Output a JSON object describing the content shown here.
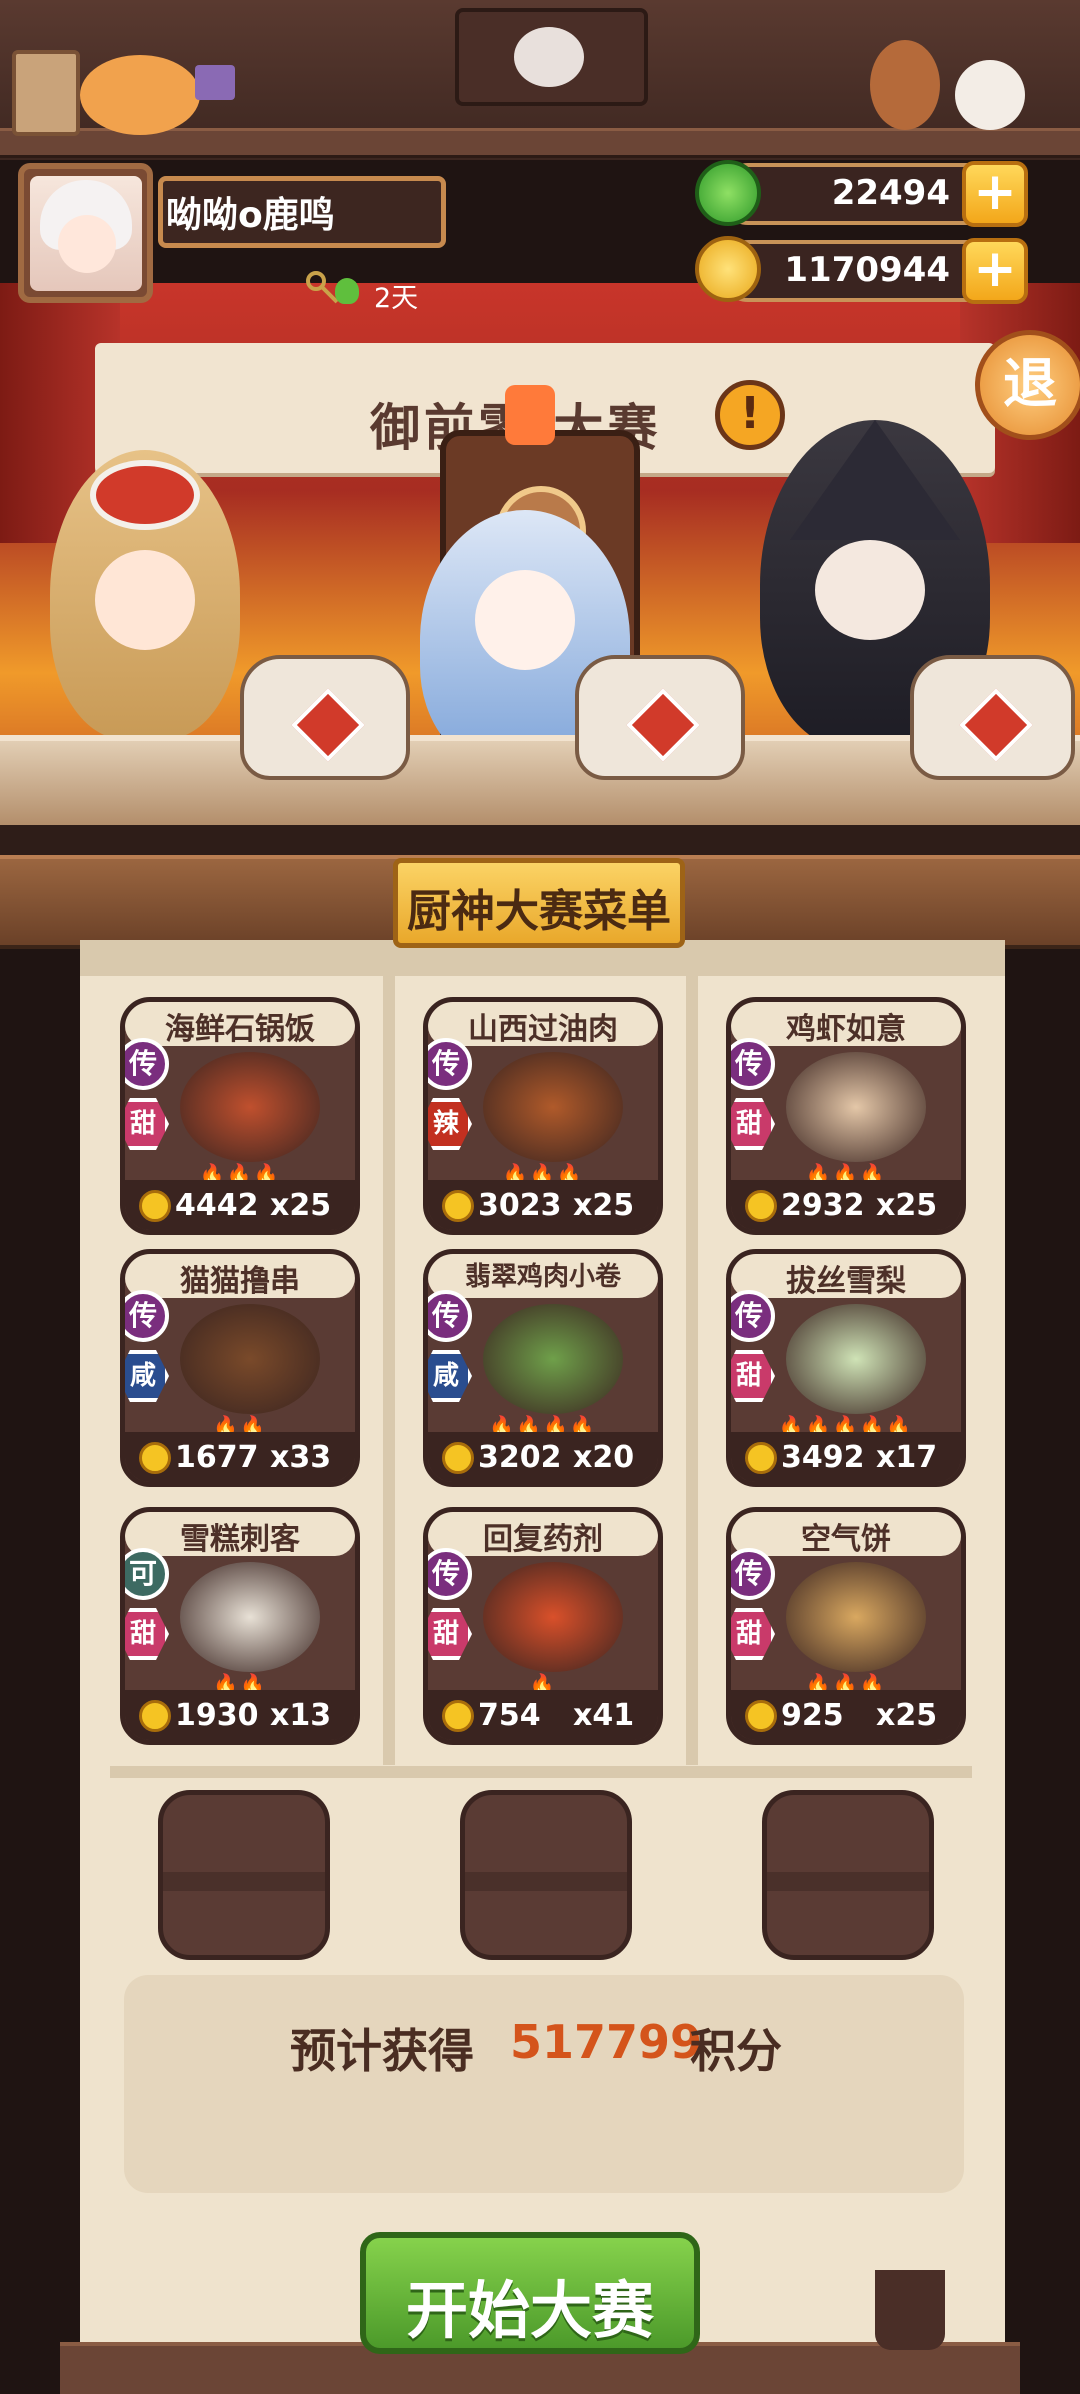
{
  "header": {
    "player_name": "呦呦o鹿鸣",
    "days": "2天",
    "jade": "22494",
    "coins": "1170944",
    "exit_label": "退"
  },
  "stage": {
    "event_title": "御前零 大赛",
    "alert_mark": "!"
  },
  "menu": {
    "title": "厨神大赛菜单",
    "dishes": [
      {
        "name": "海鲜石锅饭",
        "rarity": "传",
        "flavor": "甜",
        "flames": "🔥🔥🔥",
        "price": "4442",
        "qty": "x25"
      },
      {
        "name": "山西过油肉",
        "rarity": "传",
        "flavor": "辣",
        "flames": "🔥🔥🔥",
        "price": "3023",
        "qty": "x25"
      },
      {
        "name": "鸡虾如意",
        "rarity": "传",
        "flavor": "甜",
        "flames": "🔥🔥🔥",
        "price": "2932",
        "qty": "x25"
      },
      {
        "name": "猫猫撸串",
        "rarity": "传",
        "flavor": "咸",
        "flames": "🔥🔥",
        "price": "1677",
        "qty": "x33"
      },
      {
        "name": "翡翠鸡肉小卷",
        "rarity": "传",
        "flavor": "咸",
        "flames": "🔥🔥🔥🔥",
        "price": "3202",
        "qty": "x20"
      },
      {
        "name": "拔丝雪梨",
        "rarity": "传",
        "flavor": "甜",
        "flames": "🔥🔥🔥🔥🔥",
        "price": "3492",
        "qty": "x17"
      },
      {
        "name": "雪糕刺客",
        "rarity": "可",
        "flavor": "甜",
        "flames": "🔥🔥",
        "price": "1930",
        "qty": "x13"
      },
      {
        "name": "回复药剂",
        "rarity": "传",
        "flavor": "甜",
        "flames": "🔥",
        "price": "754",
        "qty": "x41"
      },
      {
        "name": "空气饼",
        "rarity": "传",
        "flavor": "甜",
        "flames": "🔥🔥🔥",
        "price": "925",
        "qty": "x25"
      }
    ]
  },
  "estimate": {
    "label": "预计获得",
    "value": "517799",
    "unit": "积分"
  },
  "start_button": "开始大赛",
  "colors": {
    "rarity_legend": "#7a2e7e",
    "rarity_common": "#3d6a62",
    "flavor_sweet": "#c93a6a",
    "flavor_spicy": "#c23020",
    "flavor_salty": "#2a4d8f",
    "estimate_value": "#d4541b"
  }
}
